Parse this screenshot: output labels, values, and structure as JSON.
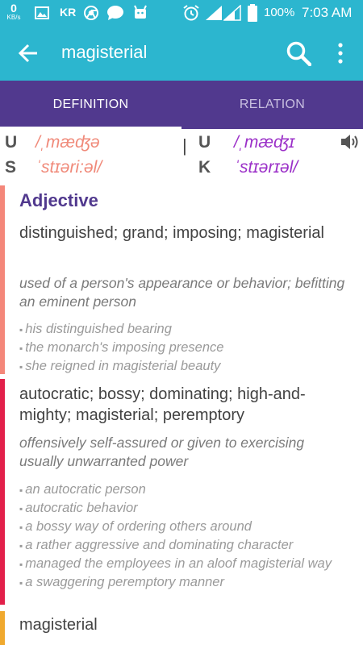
{
  "status_bar": {
    "speed_value": "0",
    "speed_unit": "KB/s",
    "carrier": "KR",
    "battery": "100%",
    "time": "7:03 AM",
    "icons": [
      "image-icon",
      "chrome-icon",
      "chat-bubble-icon",
      "android-icon",
      "alarm-icon",
      "signal-icon",
      "signal-icon",
      "battery-icon"
    ]
  },
  "toolbar": {
    "title": "magisterial",
    "color": "#2cb6cf"
  },
  "tabs": [
    {
      "label": "DEFINITION",
      "active": true
    },
    {
      "label": "RELATION",
      "active": false
    }
  ],
  "tab_color": "#51398e",
  "pronunciation": {
    "us": {
      "code_1": "U",
      "code_2": "S",
      "ipa_1": "/ˌmæʤə",
      "ipa_2": "ˈstɪəri:əl/",
      "color": "#f08a7a"
    },
    "uk": {
      "code_1": "U",
      "code_2": "K",
      "ipa_1": "/ˌmæʤɪ",
      "ipa_2": "ˈstɪərɪəl/",
      "color": "#9b30c8"
    }
  },
  "part_of_speech": "Adjective",
  "senses": [
    {
      "title": "distinguished; grand; imposing; magisterial",
      "definition": "used of a person's appearance or behavior; befitting an eminent person",
      "examples": [
        "his distinguished bearing",
        "the monarch's imposing presence",
        "she reigned in magisterial beauty"
      ],
      "color": "#f4877a"
    },
    {
      "title": "autocratic; bossy; dominating; high-and-mighty; magisterial; peremptory",
      "definition": "offensively self-assured or given to exercising usually unwarranted power",
      "examples": [
        "an autocratic person",
        "autocratic behavior",
        "a bossy way of ordering others around",
        "a rather aggressive and dominating character",
        "managed the employees in an aloof magisterial way",
        "a swaggering peremptory manner"
      ],
      "color": "#e2204a"
    },
    {
      "title": "magisterial",
      "color": "#f0a92e"
    }
  ]
}
